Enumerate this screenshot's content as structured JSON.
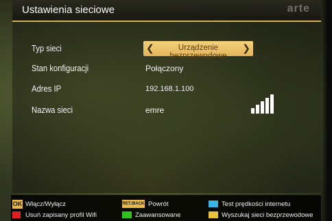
{
  "header": {
    "title": "Ustawienia sieciowe",
    "channel_logo": "arte"
  },
  "settings": {
    "network_type": {
      "label": "Typ sieci",
      "value": "Urządzenie bezprzewodowe",
      "prev_icon": "chevron-left-icon",
      "next_icon": "chevron-right-icon"
    },
    "config_state": {
      "label": "Stan konfiguracji",
      "value": "Połączony"
    },
    "ip_address": {
      "label": "Adres IP",
      "value": "192.168.1.100"
    },
    "network_name": {
      "label": "Nazwa sieci",
      "value": "emre",
      "signal_icon": "signal-strength-icon",
      "signal_bars_filled": 5,
      "signal_bars_total": 5
    }
  },
  "legend": {
    "ok_key": "OK",
    "ok_label": "Włącz/Wyłącz",
    "back_key": "RET./BACK",
    "back_label": "Powrót",
    "blue_label": "Test prędkości internetu",
    "red_label": "Usuń zapisany profil Wifi",
    "green_label": "Zaawansowane",
    "yellow_label": "Wyszukaj sieci bezprzewodowe"
  },
  "colors": {
    "accent": "#e4b45a",
    "red": "#e02020",
    "green": "#2ec21e",
    "yellow": "#e8c23a",
    "blue": "#3ab4e6"
  }
}
